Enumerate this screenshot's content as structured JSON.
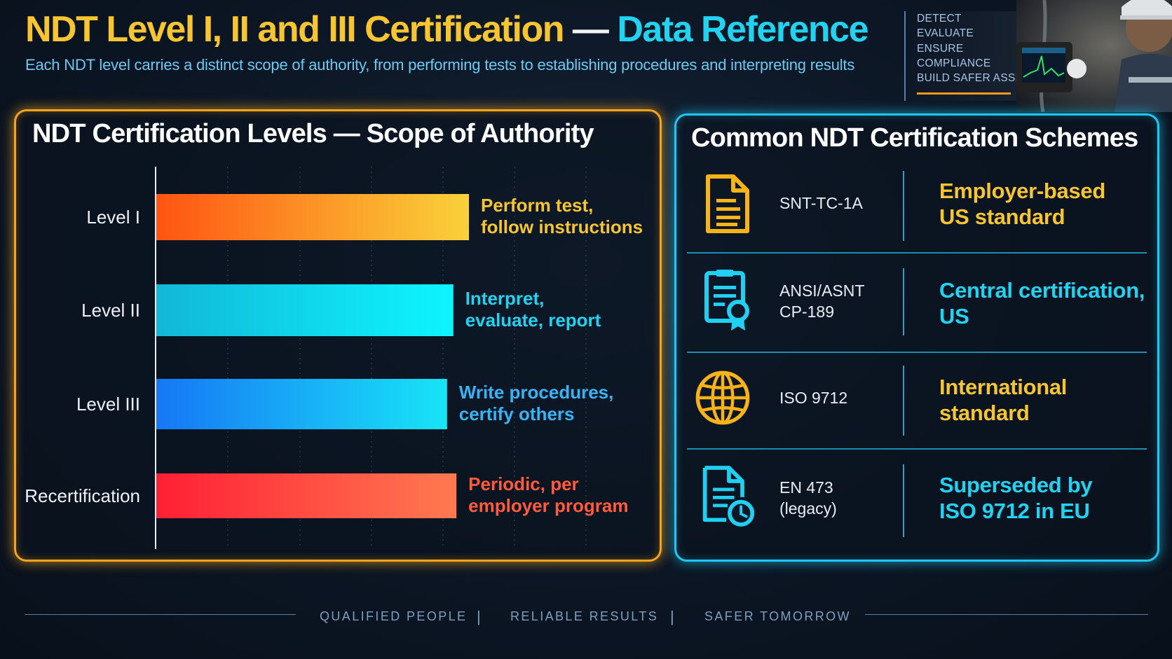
{
  "header": {
    "title_part1": "NDT Level I, II and III Certification",
    "title_sep": " — ",
    "title_part2": "Data Reference",
    "subtitle": "Each NDT level carries a distinct scope of authority, from performing tests to establishing procedures and interpreting results"
  },
  "tagline": [
    "DETECT",
    "EVALUATE",
    "ENSURE",
    "COMPLIANCE",
    "BUILD SAFER ASSETS"
  ],
  "colors": {
    "gold": "#f7c531",
    "cyan": "#21d3f0",
    "orange_frame": "#f6a41e",
    "blue_frame": "#1fc7f2",
    "red_label": "#ff5a3c"
  },
  "left_panel": {
    "title": "NDT Certification Levels — Scope of Authority"
  },
  "chart_data": {
    "type": "bar",
    "orientation": "horizontal",
    "title": "NDT Certification Levels — Scope of Authority",
    "categories": [
      "Level I",
      "Level II",
      "Level III",
      "Recertification"
    ],
    "annotations": [
      [
        "Perform test,",
        "follow instructions"
      ],
      [
        "Interpret,",
        "evaluate, report"
      ],
      [
        "Write procedures,",
        "certify others"
      ],
      [
        "Periodic, per",
        "employer program"
      ]
    ],
    "values": [
      1.0,
      0.95,
      0.93,
      0.96
    ],
    "colors": [
      [
        "#ff5412",
        "#f9d23a"
      ],
      [
        "#12b7d6",
        "#0ef5ff"
      ],
      [
        "#1677f5",
        "#19e4f6"
      ],
      [
        "#ff1f35",
        "#ff7a50"
      ]
    ],
    "label_colors": [
      "#f7c531",
      "#21d3f0",
      "#38b4f4",
      "#ff5a3c"
    ],
    "grid": true,
    "legend": "none"
  },
  "right_panel": {
    "title": "Common NDT Certification Schemes",
    "schemes": [
      {
        "icon": "document-icon",
        "name": [
          "SNT-TC-1A"
        ],
        "desc": [
          "Employer-based",
          "US standard"
        ],
        "desc_color": "#f7c531"
      },
      {
        "icon": "certificate-icon",
        "name": [
          "ANSI/ASNT",
          "CP-189"
        ],
        "desc": [
          "Central certification,",
          "US"
        ],
        "desc_color": "#21d3f0"
      },
      {
        "icon": "globe-icon",
        "name": [
          "ISO 9712"
        ],
        "desc": [
          "International",
          "standard"
        ],
        "desc_color": "#f7c531"
      },
      {
        "icon": "document-clock-icon",
        "name": [
          "EN 473",
          "(legacy)"
        ],
        "desc": [
          "Superseded by",
          "ISO 9712 in EU"
        ],
        "desc_color": "#21d3f0"
      }
    ]
  },
  "footer": {
    "items": [
      "QUALIFIED PEOPLE",
      "RELIABLE RESULTS",
      "SAFER TOMORROW"
    ],
    "separator": "|"
  }
}
